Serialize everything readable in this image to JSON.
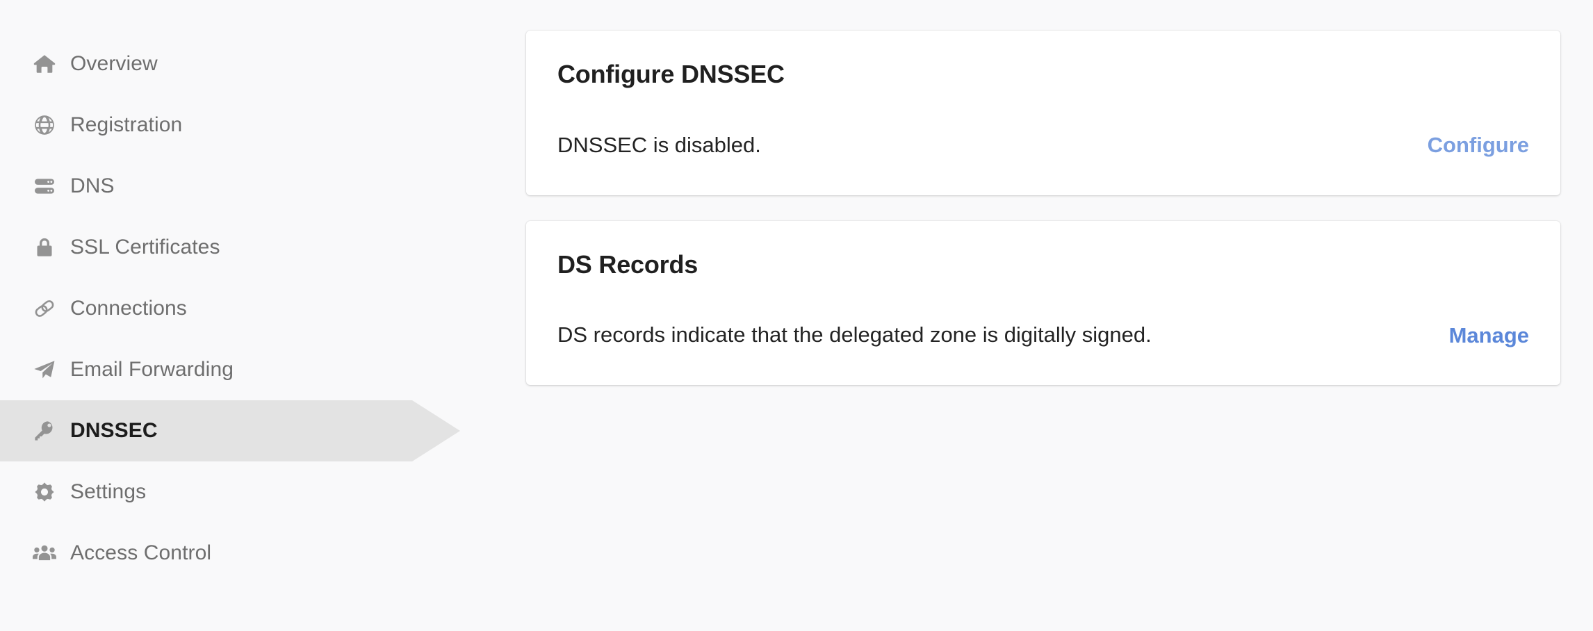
{
  "sidebar": {
    "items": [
      {
        "label": "Overview",
        "icon": "home-icon",
        "name": "sidebar-item-overview",
        "active": false
      },
      {
        "label": "Registration",
        "icon": "globe-icon",
        "name": "sidebar-item-registration",
        "active": false
      },
      {
        "label": "DNS",
        "icon": "server-icon",
        "name": "sidebar-item-dns",
        "active": false
      },
      {
        "label": "SSL Certificates",
        "icon": "lock-icon",
        "name": "sidebar-item-ssl-certificates",
        "active": false
      },
      {
        "label": "Connections",
        "icon": "link-icon",
        "name": "sidebar-item-connections",
        "active": false
      },
      {
        "label": "Email Forwarding",
        "icon": "paper-plane-icon",
        "name": "sidebar-item-email-forwarding",
        "active": false
      },
      {
        "label": "DNSSEC",
        "icon": "key-icon",
        "name": "sidebar-item-dnssec",
        "active": true
      },
      {
        "label": "Settings",
        "icon": "gear-icon",
        "name": "sidebar-item-settings",
        "active": false
      },
      {
        "label": "Access Control",
        "icon": "users-icon",
        "name": "sidebar-item-access-control",
        "active": false
      }
    ]
  },
  "main": {
    "cards": [
      {
        "title": "Configure DNSSEC",
        "description": "DNSSEC is disabled.",
        "action_label": "Configure"
      },
      {
        "title": "DS Records",
        "description": "DS records indicate that the delegated zone is digitally signed.",
        "action_label": "Manage"
      }
    ]
  },
  "colors": {
    "background": "#f9f9fa",
    "card_background": "#ffffff",
    "active_highlight": "#e3e3e3",
    "icon": "#939393",
    "nav_text": "#6e6e6e",
    "nav_text_active": "#1c1c1c",
    "title": "#202020",
    "link_blue": "#5b87d9",
    "link_blue_muted": "#7b9fe0"
  }
}
